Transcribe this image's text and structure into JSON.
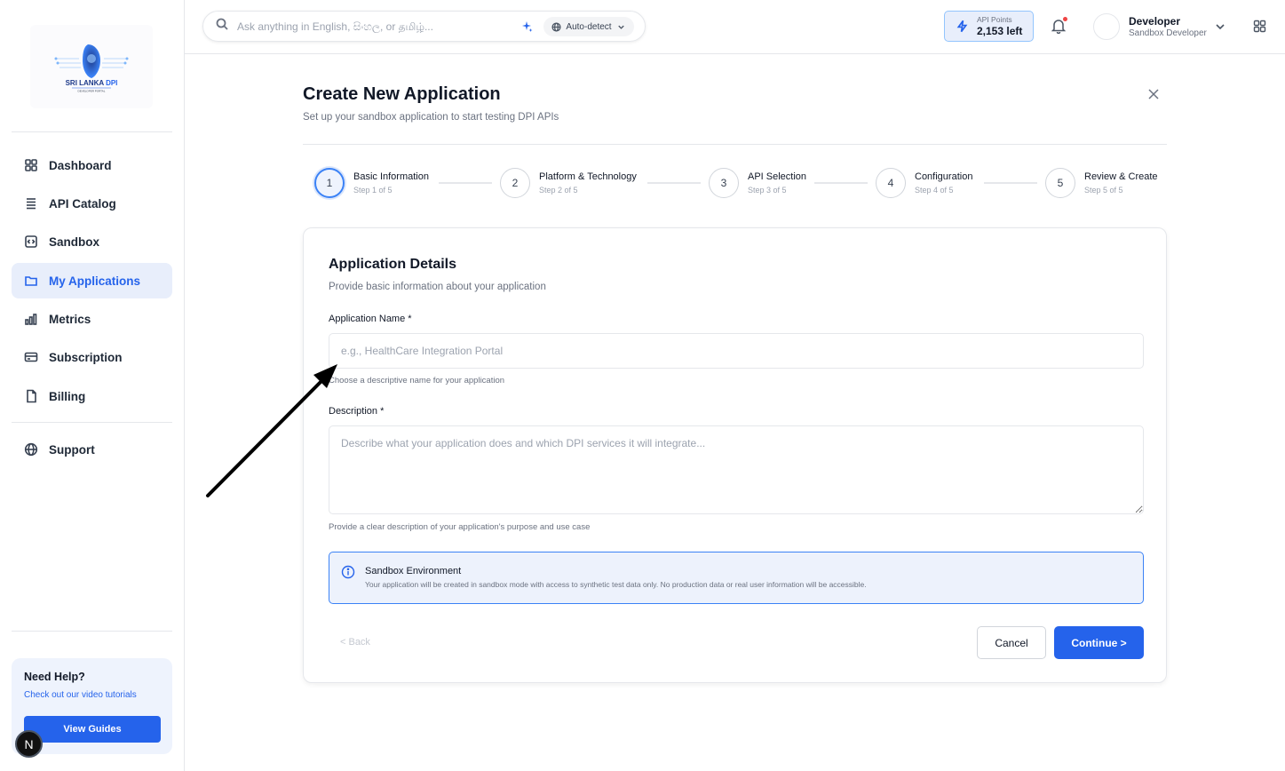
{
  "sidebar": {
    "logo_text": "SRI LANKA DPI",
    "logo_subtext": "DEVELOPER PORTAL",
    "items": [
      {
        "label": "Dashboard",
        "icon": "grid-icon"
      },
      {
        "label": "API Catalog",
        "icon": "list-icon"
      },
      {
        "label": "Sandbox",
        "icon": "code-icon"
      },
      {
        "label": "My Applications",
        "icon": "folder-icon",
        "active": true
      },
      {
        "label": "Metrics",
        "icon": "bar-chart-icon"
      },
      {
        "label": "Subscription",
        "icon": "credit-card-icon"
      },
      {
        "label": "Billing",
        "icon": "file-icon"
      },
      {
        "label": "Support",
        "icon": "globe-icon"
      }
    ],
    "help": {
      "title": "Need Help?",
      "subtitle": "Check out our video tutorials",
      "button": "View Guides"
    },
    "badge": "N"
  },
  "header": {
    "search_placeholder": "Ask anything in English, සිංහල, or தமிழ்...",
    "language_selector": "Auto-detect",
    "api_points_label": "API Points",
    "api_points_value": "2,153 left",
    "user_name": "Developer",
    "user_role": "Sandbox Developer"
  },
  "main": {
    "title": "Create New Application",
    "subtitle": "Set up your sandbox application to start testing DPI APIs",
    "steps": [
      {
        "num": "1",
        "title": "Basic Information",
        "sub": "Step 1 of 5",
        "active": true
      },
      {
        "num": "2",
        "title": "Platform & Technology",
        "sub": "Step 2 of 5"
      },
      {
        "num": "3",
        "title": "API Selection",
        "sub": "Step 3 of 5"
      },
      {
        "num": "4",
        "title": "Configuration",
        "sub": "Step 4 of 5"
      },
      {
        "num": "5",
        "title": "Review & Create",
        "sub": "Step 5 of 5"
      }
    ],
    "card": {
      "title": "Application Details",
      "subtitle": "Provide basic information about your application",
      "app_name_label": "Application Name *",
      "app_name_placeholder": "e.g., HealthCare Integration Portal",
      "app_name_value": "",
      "app_name_hint": "Choose a descriptive name for your application",
      "description_label": "Description *",
      "description_placeholder": "Describe what your application does and which DPI services it will integrate...",
      "description_value": "",
      "description_hint": "Provide a clear description of your application's purpose and use case",
      "notice_title": "Sandbox Environment",
      "notice_body": "Your application will be created in sandbox mode with access to synthetic test data only. No production data or real user information will be accessible.",
      "back_label": "< Back",
      "cancel_label": "Cancel",
      "continue_label": "Continue >"
    }
  },
  "colors": {
    "accent": "#2563eb",
    "active_bg": "#e8eefb",
    "notice_bg": "#edf2fc",
    "notification_dot": "#ef4444"
  }
}
